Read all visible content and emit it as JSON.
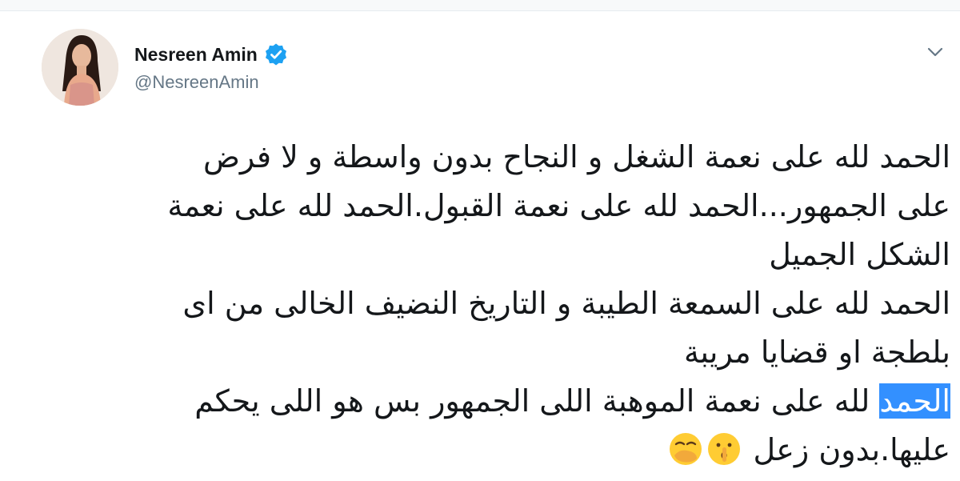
{
  "user": {
    "display_name": "Nesreen Amin",
    "handle": "@NesreenAmin",
    "verified": true
  },
  "tweet": {
    "lines": [
      "الحمد لله على نعمة الشغل و النجاح بدون واسطة و لا فرض",
      "على الجمهور...الحمد لله على نعمة القبول.الحمد لله على نعمة",
      "الشكل الجميل",
      "الحمد لله على السمعة الطيبة و التاريخ النضيف الخالى من اى",
      "بلطجة او قضايا مريبة"
    ],
    "highlighted_word": "الحمد",
    "line6_rest": " لله على نعمة الموهبة اللى الجمهور بس هو اللى يحكم",
    "line7": "عليها.بدون زعل ",
    "emojis": [
      "shushing-face-emoji",
      "hand-over-mouth-emoji"
    ]
  },
  "colors": {
    "selection": "#3390ff",
    "verified": "#1da1f2",
    "text": "#14171a",
    "secondary": "#657786"
  }
}
